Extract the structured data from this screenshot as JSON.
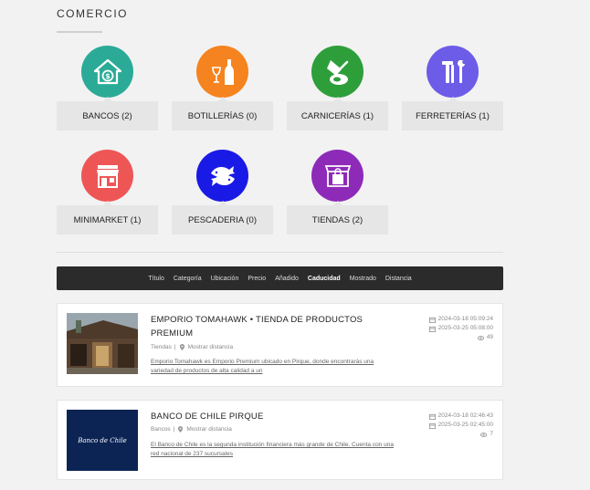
{
  "section": {
    "title": "COMERCIO"
  },
  "categories": [
    {
      "label": "BANCOS (2)",
      "color": "#2bab97",
      "icon": "bank-icon"
    },
    {
      "label": "BOTILLERÍAS (0)",
      "color": "#f5831f",
      "icon": "bottle-icon"
    },
    {
      "label": "CARNICERÍAS (1)",
      "color": "#2e9e3b",
      "icon": "meat-cleaver-icon"
    },
    {
      "label": "FERRETERÍAS (1)",
      "color": "#6c5ce7",
      "icon": "tools-icon"
    },
    {
      "label": "MINIMARKET (1)",
      "color": "#ee5656",
      "icon": "store-icon"
    },
    {
      "label": "PESCADERIA (0)",
      "color": "#1a1ae6",
      "icon": "fish-icon"
    },
    {
      "label": "TIENDAS (2)",
      "color": "#8e2ab8",
      "icon": "shop-bag-icon"
    }
  ],
  "sortbar": {
    "items": [
      "Título",
      "Categoría",
      "Ubicación",
      "Precio",
      "Añadido",
      "Caducidad",
      "Mostrado",
      "Distancia"
    ],
    "active": "Caducidad"
  },
  "listings": [
    {
      "title": "EMPORIO TOMAHAWK • TIENDA DE PRODUCTOS PREMIUM",
      "category": "Tiendas",
      "distance": "Mostrar distancia",
      "description": "Emporio Tomahawk es Emporio Premium ubicado en Pirque, donde encontrarás una variedad de productos de alta calidad a un",
      "added": "2024-03-18 05:09:24",
      "expires": "2025-03-25 05:08:00",
      "views": "49"
    },
    {
      "title": "BANCO DE CHILE PIRQUE",
      "category": "Bancos",
      "distance": "Mostrar distancia",
      "description": "El Banco de Chile es la segunda institución financiera más grande de Chile. Cuenta con una red nacional de 237 sucursales",
      "added": "2024-03-18 02:46:43",
      "expires": "2025-03-25 02:45:00",
      "views": "7",
      "thumb_text": "Banco de Chile"
    }
  ]
}
